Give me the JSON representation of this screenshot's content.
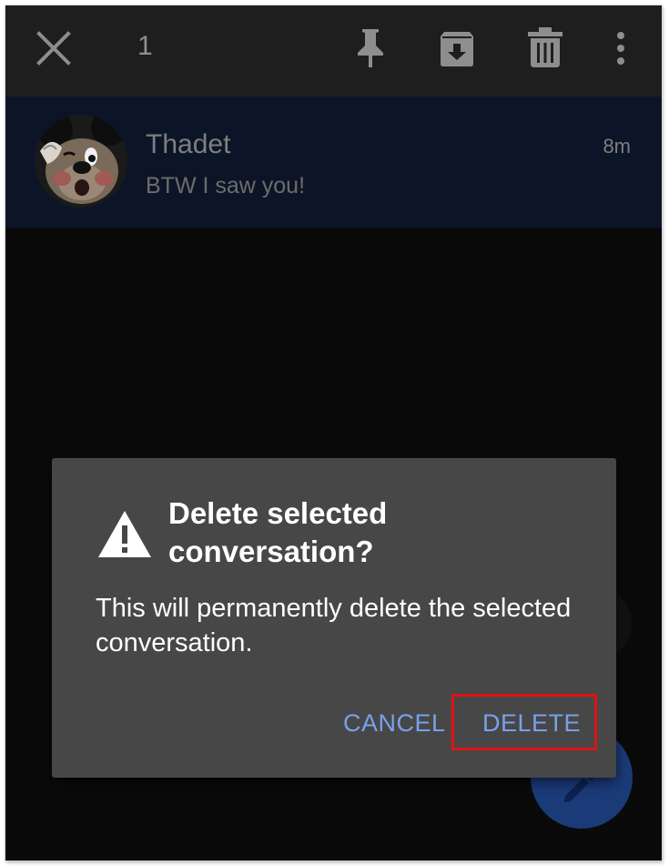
{
  "topbar": {
    "selected_count": "1",
    "icons": [
      "close-icon",
      "pin-icon",
      "archive-icon",
      "trash-icon",
      "more-vert-icon"
    ]
  },
  "conversation": {
    "name": "Thadet",
    "snippet": "BTW I saw you!",
    "time": "8m"
  },
  "dialog": {
    "title": "Delete selected conversation?",
    "body": "This will permanently delete the selected conversation.",
    "cancel_label": "CANCEL",
    "delete_label": "DELETE",
    "icon": "warning-icon"
  },
  "colors": {
    "accent_text": "#7aa0ec",
    "highlight_box": "#e01212",
    "fab": "#1b3a78",
    "selected_row": "#0c1527"
  }
}
